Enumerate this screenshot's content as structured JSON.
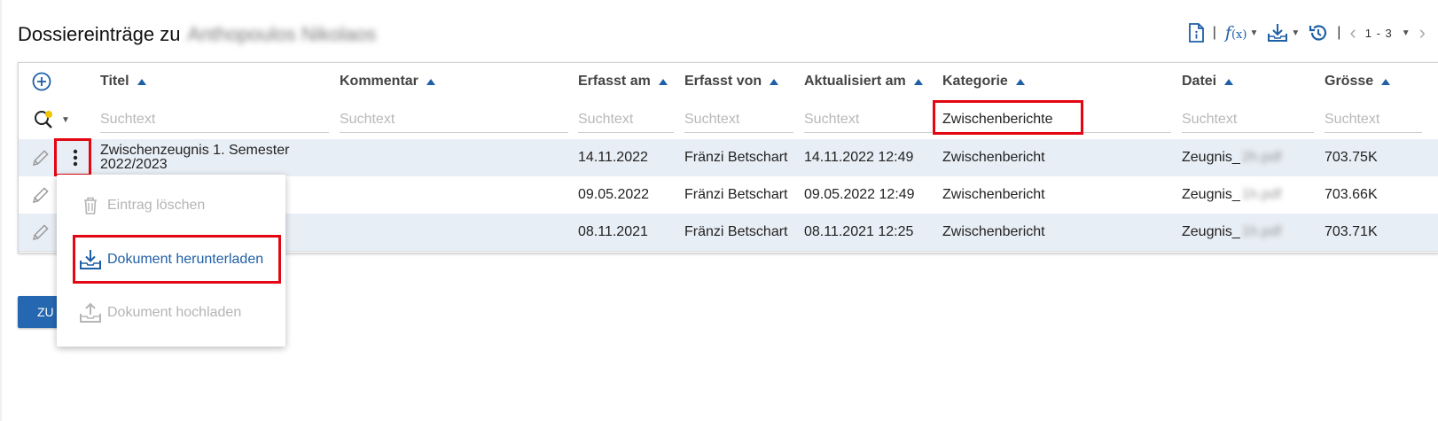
{
  "page": {
    "title": "Dossiereinträge zu",
    "person_name_blurred": "Anthopoulos Nikolaos"
  },
  "toolbar": {
    "fx_label": "f",
    "fx_sub": "(x)",
    "separator": "|",
    "paging": "1 - 3",
    "icons": [
      "document-info-icon",
      "function-icon",
      "download-icon",
      "history-icon",
      "chevron-left-icon",
      "chevron-right-icon"
    ]
  },
  "table": {
    "columns": [
      {
        "key": "titel",
        "label": "Titel"
      },
      {
        "key": "kommentar",
        "label": "Kommentar"
      },
      {
        "key": "erfasst_am",
        "label": "Erfasst am"
      },
      {
        "key": "erfasst_von",
        "label": "Erfasst von"
      },
      {
        "key": "aktualisiert_am",
        "label": "Aktualisiert am"
      },
      {
        "key": "kategorie",
        "label": "Kategorie"
      },
      {
        "key": "datei",
        "label": "Datei"
      },
      {
        "key": "groesse",
        "label": "Grösse"
      }
    ],
    "filter_placeholder": "Suchtext",
    "filter_values": {
      "kategorie": "Zwischenberichte"
    },
    "rows": [
      {
        "titel_line1": "Zwischenzeugnis 1. Semester",
        "titel_line2": "2022/2023",
        "kommentar": "",
        "erfasst_am": "14.11.2022",
        "erfasst_von": "Fränzi Betschart",
        "aktualisiert_am": "14.11.2022 12:49",
        "kategorie": "Zwischenbericht",
        "datei": "Zeugnis_",
        "datei_blurred": "2h.pdf",
        "groesse": "703.75K"
      },
      {
        "titel_line1": "",
        "titel_line2": "",
        "kommentar": "",
        "erfasst_am": "09.05.2022",
        "erfasst_von": "Fränzi Betschart",
        "aktualisiert_am": "09.05.2022 12:49",
        "kategorie": "Zwischenbericht",
        "datei": "Zeugnis_",
        "datei_blurred": "1h.pdf",
        "groesse": "703.66K"
      },
      {
        "titel_line1": "",
        "titel_line2": "",
        "kommentar": "",
        "erfasst_am": "08.11.2021",
        "erfasst_von": "Fränzi Betschart",
        "aktualisiert_am": "08.11.2021 12:25",
        "kategorie": "Zwischenbericht",
        "datei": "Zeugnis_",
        "datei_blurred": "1h.pdf",
        "groesse": "703.71K"
      }
    ]
  },
  "context_menu": {
    "items": [
      {
        "label": "Eintrag löschen",
        "icon": "trash-icon",
        "enabled": false
      },
      {
        "label": "Dokument herunterladen",
        "icon": "download-tray-icon",
        "enabled": true
      },
      {
        "label": "Dokument hochladen",
        "icon": "upload-tray-icon",
        "enabled": false
      }
    ]
  },
  "bottom_button": {
    "label": "ZU"
  },
  "colors": {
    "accent": "#1f5fa5",
    "highlight": "#e30613",
    "row_alt": "#e8eef5",
    "disabled": "#b5b5b5"
  }
}
